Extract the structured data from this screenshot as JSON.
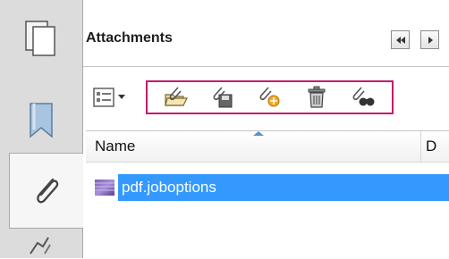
{
  "panel": {
    "title": "Attachments"
  },
  "columns": {
    "name": "Name",
    "description_truncated": "D"
  },
  "attachments": [
    {
      "name": "pdf.joboptions",
      "selected": true
    }
  ],
  "toolbar": {
    "icons": [
      "options-icon",
      "open-attachment-icon",
      "save-attachment-icon",
      "add-attachment-icon",
      "delete-icon",
      "search-attachments-icon"
    ]
  },
  "left_tabs": [
    "page-thumbnails-icon",
    "bookmarks-icon",
    "attachments-icon",
    "signatures-icon"
  ],
  "colors": {
    "highlight_border": "#c41b6e",
    "selection": "#3399ff"
  }
}
